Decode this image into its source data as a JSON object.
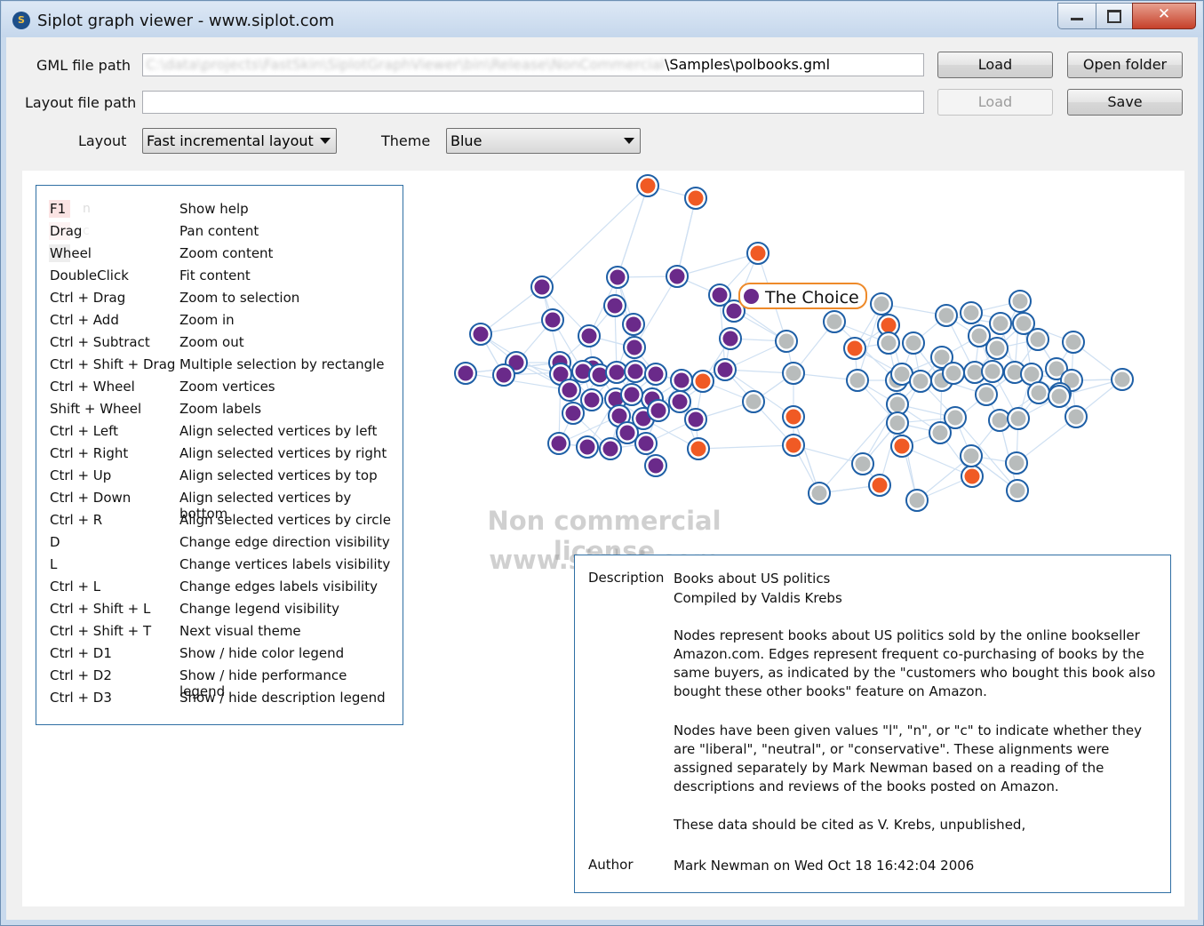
{
  "window": {
    "title": "Siplot graph viewer - www.siplot.com",
    "icon_letter": "S"
  },
  "controls": {
    "gml_label": "GML file path",
    "gml_path_hidden": "C:\\data\\projects\\FastSkin\\SiplotGraphViewer\\bin\\Release\\NonCommercial",
    "gml_path_visible": "\\Samples\\polbooks.gml",
    "layout_path_label": "Layout file path",
    "layout_path_value": "",
    "load_label": "Load",
    "open_folder_label": "Open folder",
    "save_label": "Save",
    "layout_label": "Layout",
    "layout_value": "Fast incremental layout",
    "theme_label": "Theme",
    "theme_value": "Blue"
  },
  "help": [
    {
      "key": "F1",
      "action": "Show help"
    },
    {
      "key": "Drag",
      "action": "Pan content"
    },
    {
      "key": "Wheel",
      "action": "Zoom content"
    },
    {
      "key": "DoubleClick",
      "action": "Fit content"
    },
    {
      "key": "Ctrl + Drag",
      "action": "Zoom to selection"
    },
    {
      "key": "Ctrl + Add",
      "action": "Zoom in"
    },
    {
      "key": "Ctrl + Subtract",
      "action": "Zoom out"
    },
    {
      "key": "Ctrl + Shift + Drag",
      "action": "Multiple selection by rectangle"
    },
    {
      "key": "Ctrl + Wheel",
      "action": "Zoom vertices"
    },
    {
      "key": "Shift + Wheel",
      "action": "Zoom labels"
    },
    {
      "key": "Ctrl + Left",
      "action": "Align selected vertices by left"
    },
    {
      "key": "Ctrl + Right",
      "action": "Align selected vertices by right"
    },
    {
      "key": "Ctrl + Up",
      "action": "Align selected vertices by top"
    },
    {
      "key": "Ctrl + Down",
      "action": "Align selected vertices by bottom"
    },
    {
      "key": "Ctrl + R",
      "action": "Align selected vertices by circle"
    },
    {
      "key": "D",
      "action": "Change edge direction visibility"
    },
    {
      "key": "L",
      "action": "Change vertices labels visibility"
    },
    {
      "key": "Ctrl + L",
      "action": "Change edges labels visibility"
    },
    {
      "key": "Ctrl + Shift + L",
      "action": "Change legend visibility"
    },
    {
      "key": "Ctrl + Shift + T",
      "action": "Next visual theme"
    },
    {
      "key": "Ctrl + D1",
      "action": "Show / hide color legend"
    },
    {
      "key": "Ctrl + D2",
      "action": "Show / hide performance legend"
    },
    {
      "key": "Ctrl + D3",
      "action": "Show / hide description legend"
    }
  ],
  "legend_ghost": [
    "n",
    "c"
  ],
  "watermark": {
    "line1": "Non commercial license",
    "line2": "www.siplot.com"
  },
  "vertex_label": "The Choice",
  "description": {
    "label": "Description",
    "line1": "Books about US politics",
    "line2": "Compiled by Valdis Krebs",
    "para1": "Nodes represent books about US politics sold by the online bookseller Amazon.com.  Edges represent frequent co-purchasing of books by the same buyers, as indicated by the \"customers who bought this book also bought these other books\" feature on Amazon.",
    "para2": "Nodes have been given values \"l\", \"n\", or \"c\" to indicate whether they are \"liberal\", \"neutral\", or \"conservative\".  These alignments were assigned separately by Mark Newman based on a reading of the descriptions and reviews of the books posted on Amazon.",
    "para3": "These data should be cited as V. Krebs, unpublished,",
    "author_label": "Author",
    "author_value": "Mark Newman on Wed Oct 18 16:42:04 2006"
  },
  "colors": {
    "liberal": "#6a2a8a",
    "neutral": "#f05a24",
    "conservative": "#b8bcbc",
    "ring": "#1e5fa6",
    "edge": "#cfe0f2"
  }
}
